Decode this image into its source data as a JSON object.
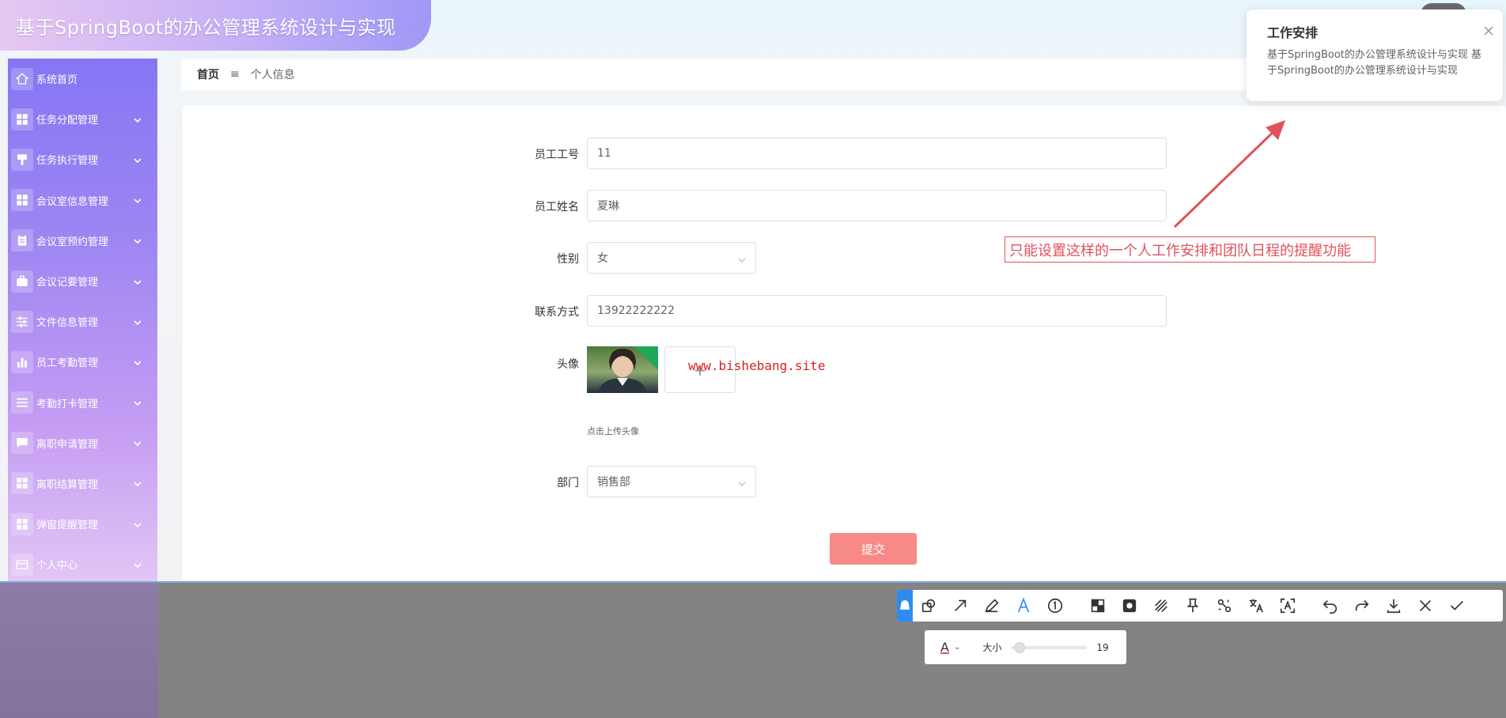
{
  "app": {
    "title": "基于SpringBoot的办公管理系统设计与实现"
  },
  "sidebar": {
    "items": [
      {
        "label": "系统首页",
        "icon": "home-icon"
      },
      {
        "label": "任务分配管理",
        "icon": "grid-icon"
      },
      {
        "label": "任务执行管理",
        "icon": "brush-icon"
      },
      {
        "label": "会议室信息管理",
        "icon": "grid-icon"
      },
      {
        "label": "会议室预约管理",
        "icon": "clipboard-icon"
      },
      {
        "label": "会议记要管理",
        "icon": "briefcase-icon"
      },
      {
        "label": "文件信息管理",
        "icon": "sliders-icon"
      },
      {
        "label": "员工考勤管理",
        "icon": "bar-chart-icon"
      },
      {
        "label": "考勤打卡管理",
        "icon": "list-icon"
      },
      {
        "label": "离职申请管理",
        "icon": "chat-icon"
      },
      {
        "label": "离职结算管理",
        "icon": "grid-icon"
      },
      {
        "label": "弹窗提醒管理",
        "icon": "grid-icon"
      },
      {
        "label": "个人中心",
        "icon": "id-card-icon"
      }
    ]
  },
  "breadcrumb": {
    "home": "首页",
    "separator": "≡",
    "current": "个人信息"
  },
  "form": {
    "employee_no": {
      "label": "员工工号",
      "value": "11"
    },
    "employee_name": {
      "label": "员工姓名",
      "value": "夏琳"
    },
    "gender": {
      "label": "性别",
      "value": "女"
    },
    "contact": {
      "label": "联系方式",
      "value": "13922222222"
    },
    "avatar": {
      "label": "头像",
      "upload_hint": "点击上传头像",
      "upload_symbol": "+"
    },
    "department": {
      "label": "部门",
      "value": "销售部"
    },
    "submit_label": "提交"
  },
  "watermark": "www.bishebang.site",
  "annotation": {
    "text": "只能设置这样的一个人工作安排和团队日程的提醒功能",
    "color": "#e0525b"
  },
  "notification": {
    "title": "工作安排",
    "body": "基于SpringBoot的办公管理系统设计与实现 基于SpringBoot的办公管理系统设计与实现"
  },
  "screenshot_tool": {
    "tools": [
      "pin-icon",
      "shape-icon",
      "arrow-icon",
      "pen-icon",
      "text-icon",
      "number-icon",
      "mosaic-icon",
      "blur-icon",
      "hatch-icon",
      "pin-top-icon",
      "scan-icon",
      "translate-icon",
      "ocr-icon",
      "undo-icon",
      "redo-icon",
      "download-icon",
      "close-icon",
      "check-icon"
    ],
    "size_label": "大小",
    "size_value": "19",
    "size_level": 0.05,
    "font_color_label": "A",
    "font_color": "#e0525b"
  }
}
